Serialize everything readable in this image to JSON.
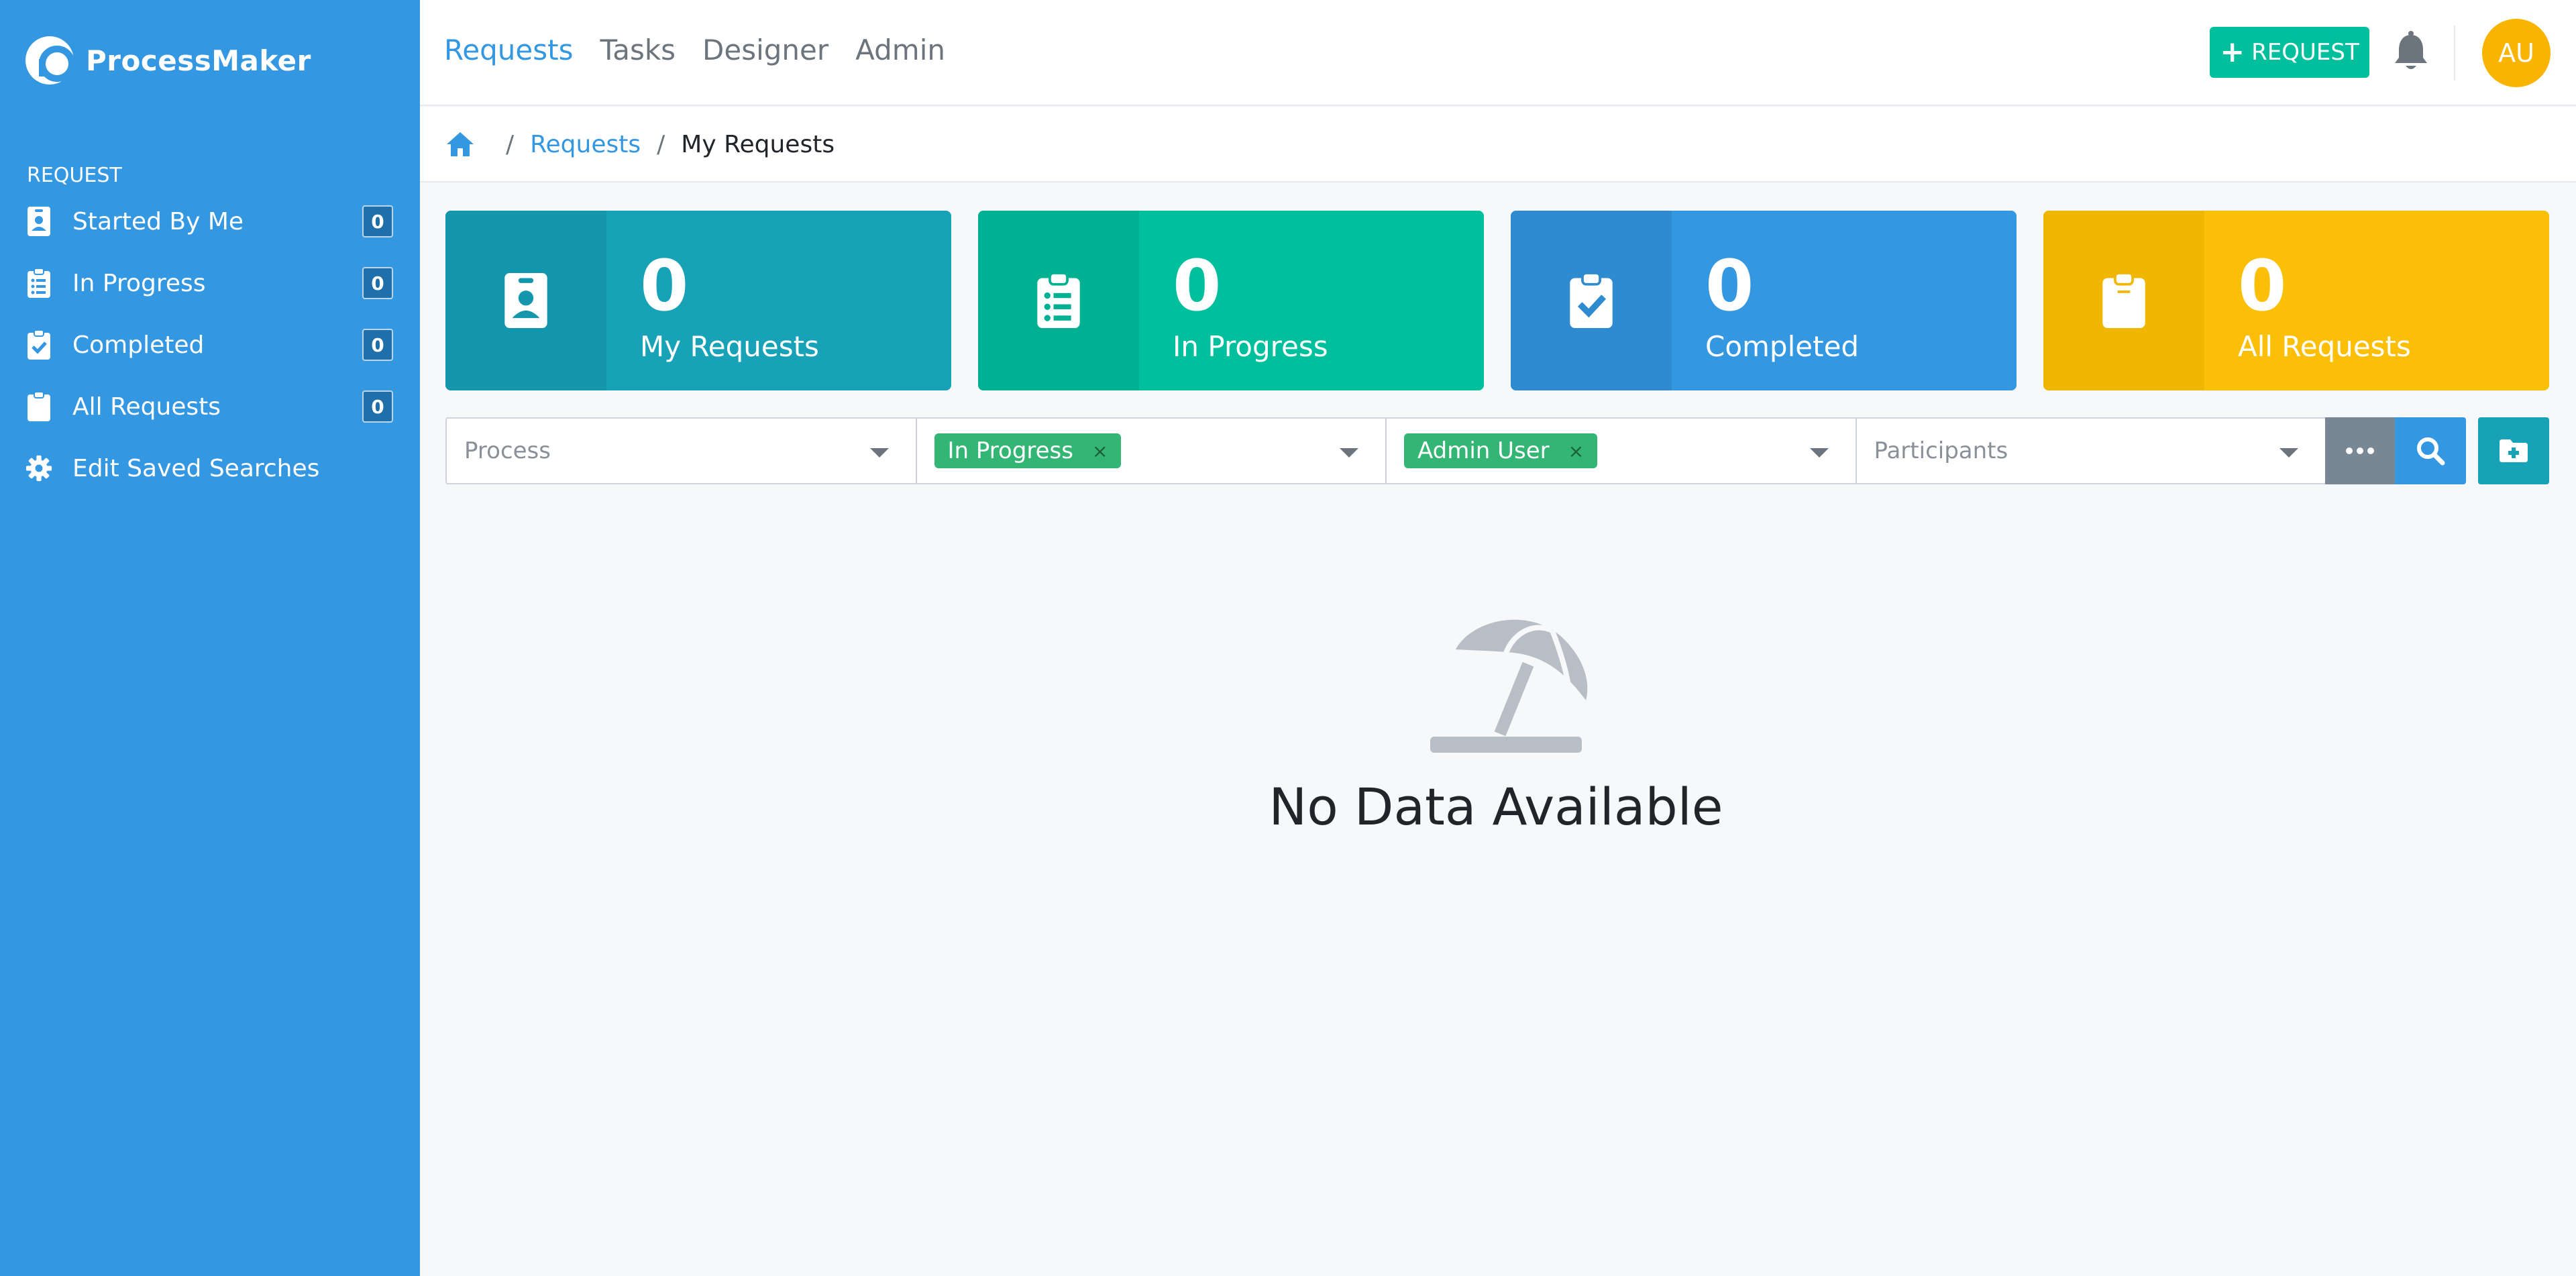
{
  "app": {
    "name": "ProcessMaker"
  },
  "sidebar": {
    "section_title": "REQUEST",
    "items": [
      {
        "label": "Started By Me",
        "count": "0",
        "icon": "id-badge-icon"
      },
      {
        "label": "In Progress",
        "count": "0",
        "icon": "clipboard-list-icon"
      },
      {
        "label": "Completed",
        "count": "0",
        "icon": "clipboard-check-icon"
      },
      {
        "label": "All Requests",
        "count": "0",
        "icon": "clipboard-icon"
      },
      {
        "label": "Edit Saved Searches",
        "icon": "gear-icon"
      }
    ]
  },
  "topnav": {
    "items": [
      "Requests",
      "Tasks",
      "Designer",
      "Admin"
    ],
    "active": "Requests",
    "request_button": "REQUEST",
    "avatar_initials": "AU"
  },
  "breadcrumb": {
    "link": "Requests",
    "current": "My Requests"
  },
  "cards": [
    {
      "count": "0",
      "label": "My Requests",
      "color": "#17a2b8",
      "icon_bg": "#1497ad",
      "icon": "id-badge-icon"
    },
    {
      "count": "0",
      "label": "In Progress",
      "color": "#00bf9c",
      "icon_bg": "#00b092",
      "icon": "clipboard-list-icon"
    },
    {
      "count": "0",
      "label": "Completed",
      "color": "#3397e1",
      "icon_bg": "#2f8bd0",
      "icon": "clipboard-check-icon"
    },
    {
      "count": "0",
      "label": "All Requests",
      "color": "#fbbf08",
      "icon_bg": "#f1b600",
      "icon": "clipboard-icon"
    }
  ],
  "filters": {
    "process_placeholder": "Process",
    "status_tag": "In Progress",
    "requester_tag": "Admin User",
    "participants_placeholder": "Participants"
  },
  "empty": {
    "message": "No Data Available",
    "icon": "umbrella-beach-icon"
  },
  "colors": {
    "sidebar": "#3397e1",
    "accent": "#3397e1",
    "success": "#00bf9c",
    "tag": "#33b574"
  }
}
